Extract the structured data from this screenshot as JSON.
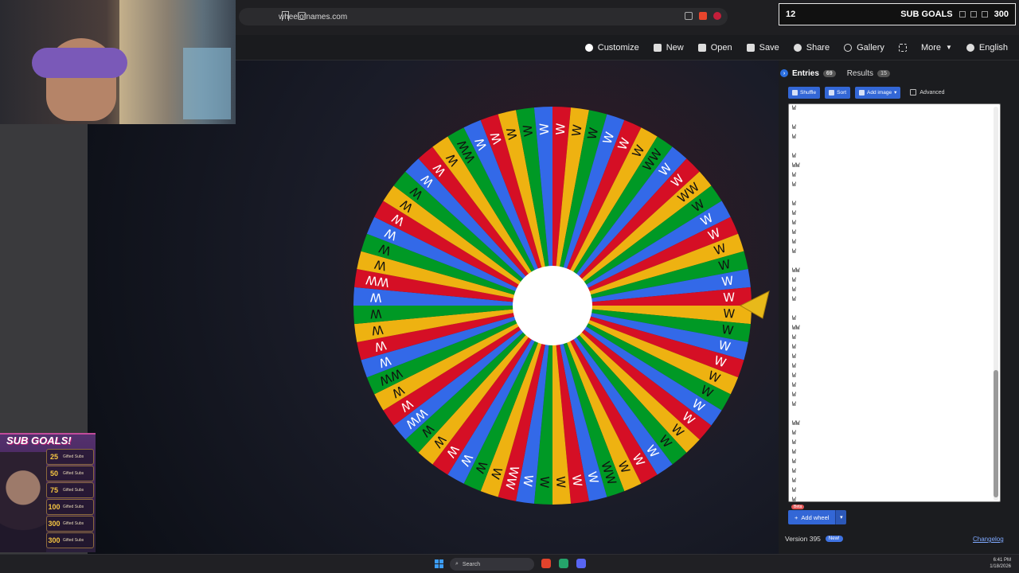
{
  "browser": {
    "url": "wheelofnames.com"
  },
  "stream_overlay": {
    "top_left_number": "12",
    "title": "SUB GOALS",
    "top_right_number": "300"
  },
  "header": {
    "items": [
      {
        "label": "Customize",
        "icon": "palette-icon"
      },
      {
        "label": "New",
        "icon": "file-icon"
      },
      {
        "label": "Open",
        "icon": "folder-icon"
      },
      {
        "label": "Save",
        "icon": "save-icon"
      },
      {
        "label": "Share",
        "icon": "share-icon"
      },
      {
        "label": "Gallery",
        "icon": "search-icon"
      },
      {
        "label": "",
        "icon": "fullscreen-icon"
      },
      {
        "label": "More",
        "icon": "chevron-down-icon"
      },
      {
        "label": "English",
        "icon": "globe-icon"
      }
    ]
  },
  "wheel": {
    "colors": [
      "#3369e8",
      "#d50f25",
      "#eeb211",
      "#009925"
    ],
    "segment_count": 68,
    "labels": [
      "W",
      "W",
      "W",
      "W",
      "W",
      "W",
      "WW",
      "W",
      "W",
      "WW",
      "W",
      "W",
      "W",
      "W",
      "W",
      "W",
      "W",
      "W",
      "W",
      "W",
      "W",
      "W",
      "W",
      "W",
      "W",
      "W",
      "W",
      "W",
      "W",
      "W",
      "WW",
      "W",
      "W",
      "W",
      "W",
      "W",
      "WW",
      "W",
      "W",
      "W",
      "W",
      "W",
      "W",
      "WW",
      "W",
      "W",
      "WW",
      "W",
      "W",
      "W",
      "W",
      "W",
      "WW",
      "W",
      "W",
      "W",
      "W",
      "W",
      "W",
      "W",
      "W",
      "W",
      "WW",
      "W",
      "W",
      "W",
      "W",
      "W"
    ],
    "pointer_color": "#e8b91a"
  },
  "panel": {
    "tabs": [
      {
        "label": "Entries",
        "count": "69",
        "active": true
      },
      {
        "label": "Results",
        "count": "15",
        "active": false
      }
    ],
    "toolbar": {
      "shuffle": "Shuffle",
      "sort": "Sort",
      "add_image": "Add image",
      "advanced": "Advanced"
    },
    "entries": [
      "W",
      "",
      "W",
      "W",
      "",
      "W",
      "WW",
      "W",
      "W",
      "",
      "W",
      "W",
      "W",
      "W",
      "W",
      "W",
      "",
      "WW",
      "W",
      "W",
      "W",
      "",
      "W",
      "WW",
      "W",
      "W",
      "W",
      "W",
      "W",
      "W",
      "W",
      "W",
      "",
      "WW",
      "W",
      "W",
      "W",
      "W",
      "W",
      "W",
      "W",
      "W"
    ],
    "beta": "Beta",
    "add_wheel": "Add wheel",
    "version": "Version 395",
    "new_badge": "New!",
    "changelog": "Changelog"
  },
  "subgoals_card": {
    "title": "SUB GOALS!",
    "goals": [
      {
        "num": "25",
        "text": "Gifted Subs"
      },
      {
        "num": "50",
        "text": "Gifted Subs"
      },
      {
        "num": "75",
        "text": "Gifted Subs"
      },
      {
        "num": "100",
        "text": "Gifted Subs"
      },
      {
        "num": "300",
        "text": "Gifted Subs"
      },
      {
        "num": "300",
        "text": "Gifted Subs"
      }
    ]
  },
  "taskbar": {
    "search_placeholder": "Search",
    "time": "6:41 PM",
    "date": "1/18/2026"
  }
}
